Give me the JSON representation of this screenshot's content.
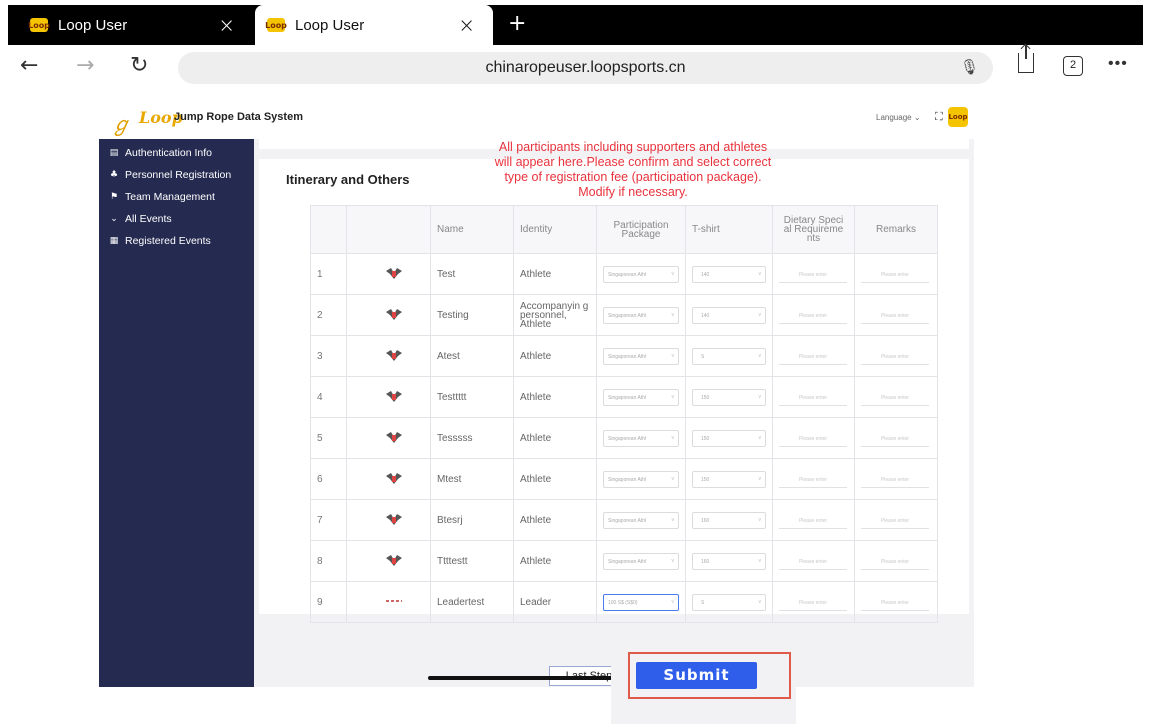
{
  "browser": {
    "tabs": [
      {
        "label": "Loop User",
        "favicon": "Loop"
      },
      {
        "label": "Loop User",
        "favicon": "Loop"
      }
    ],
    "url": "chinaropeuser.loopsports.cn",
    "tab_count": "2"
  },
  "app": {
    "logo_text": "Loop",
    "title": "Jump Rope Data System",
    "language_label": "Language",
    "avatar_text": "Loop"
  },
  "sidebar": {
    "items": [
      {
        "label": "Authentication Info",
        "icon": "id-card-icon"
      },
      {
        "label": "Personnel Registration",
        "icon": "people-icon"
      },
      {
        "label": "Team Management",
        "icon": "flag-icon"
      },
      {
        "label": "All Events",
        "icon": "chevron-icon"
      },
      {
        "label": "Registered Events",
        "icon": "list-icon"
      }
    ]
  },
  "main": {
    "section_title": "Itinerary and Others",
    "notice_lines": [
      "All participants including supporters and athletes",
      "will appear here.Please confirm and select correct",
      "type of registration fee (participation package).",
      "Modify if necessary."
    ],
    "table": {
      "headers": [
        "",
        "",
        "Name",
        "Identity",
        "Participation Package",
        "T-shirt",
        "Dietary Speci al Requireme nts",
        "Remarks"
      ],
      "placeholder": "Please enter",
      "rows": [
        {
          "num": "1",
          "name": "Test",
          "identity": "Athlete",
          "package": "Singaporean Athl",
          "tshirt": "140"
        },
        {
          "num": "2",
          "name": "Testing",
          "identity": "Accompanyin g personnel, Athlete",
          "package": "Singaporean Athl",
          "tshirt": "140"
        },
        {
          "num": "3",
          "name": "Atest",
          "identity": "Athlete",
          "package": "Singaporean Athl",
          "tshirt": "S"
        },
        {
          "num": "4",
          "name": "Testtttt",
          "identity": "Athlete",
          "package": "Singaporean Athl",
          "tshirt": "150"
        },
        {
          "num": "5",
          "name": "Tesssss",
          "identity": "Athlete",
          "package": "Singaporean Athl",
          "tshirt": "150"
        },
        {
          "num": "6",
          "name": "Mtest",
          "identity": "Athlete",
          "package": "Singaporean Athl",
          "tshirt": "150"
        },
        {
          "num": "7",
          "name": "Btesrj",
          "identity": "Athlete",
          "package": "Singaporean Athl",
          "tshirt": "160"
        },
        {
          "num": "8",
          "name": "Ttttestt",
          "identity": "Athlete",
          "package": "Singaporean Athl",
          "tshirt": "160"
        },
        {
          "num": "9",
          "name": "Leadertest",
          "identity": "Leader",
          "package": "100 S$ (S$0)",
          "tshirt": "S"
        }
      ]
    }
  },
  "footer": {
    "last_step_label": "Last Step",
    "submit_label": "Submit"
  },
  "colors": {
    "sidebar_bg": "#252a50",
    "notice_red": "#e8323c",
    "submit_blue": "#2f5eea",
    "highlight_outline": "#e05a4a"
  }
}
